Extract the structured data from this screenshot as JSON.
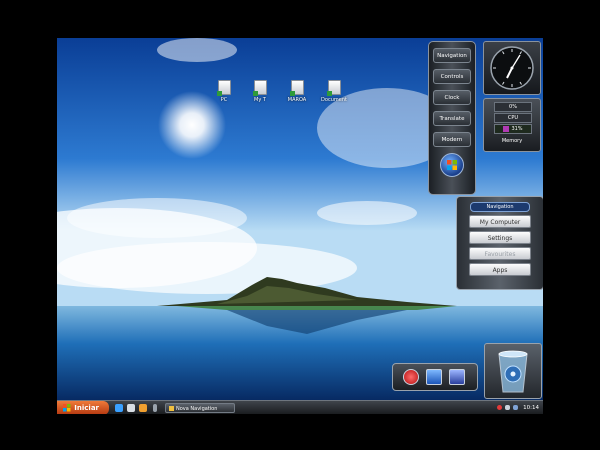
{
  "desktop": {
    "icons": [
      {
        "label": "PC"
      },
      {
        "label": "My T"
      },
      {
        "label": "MAROA"
      },
      {
        "label": "Document"
      }
    ]
  },
  "nav_panel": {
    "items": [
      "Navigation",
      "Controls",
      "Clock",
      "Translate",
      "Modern"
    ],
    "orb_icon": "windows-orb-icon"
  },
  "cpu_gadget": {
    "top": "0%",
    "middle": "CPU",
    "usage": "31%",
    "footer": "Memory"
  },
  "quick_panel": {
    "title": "Navigation",
    "items": [
      {
        "label": "My Computer",
        "disabled": false
      },
      {
        "label": "Settings",
        "disabled": false
      },
      {
        "label": "Favourites",
        "disabled": true
      },
      {
        "label": "Apps",
        "disabled": false
      }
    ]
  },
  "bottom_buttons": [
    "power-icon",
    "window-icon",
    "shield-icon"
  ],
  "taskbar": {
    "start_label": "Iniciar",
    "task_label": "Nova Navigation",
    "time": "10:14",
    "brand_colors": {
      "start": "#e05a20",
      "taskbar": "#2a2e33"
    }
  }
}
